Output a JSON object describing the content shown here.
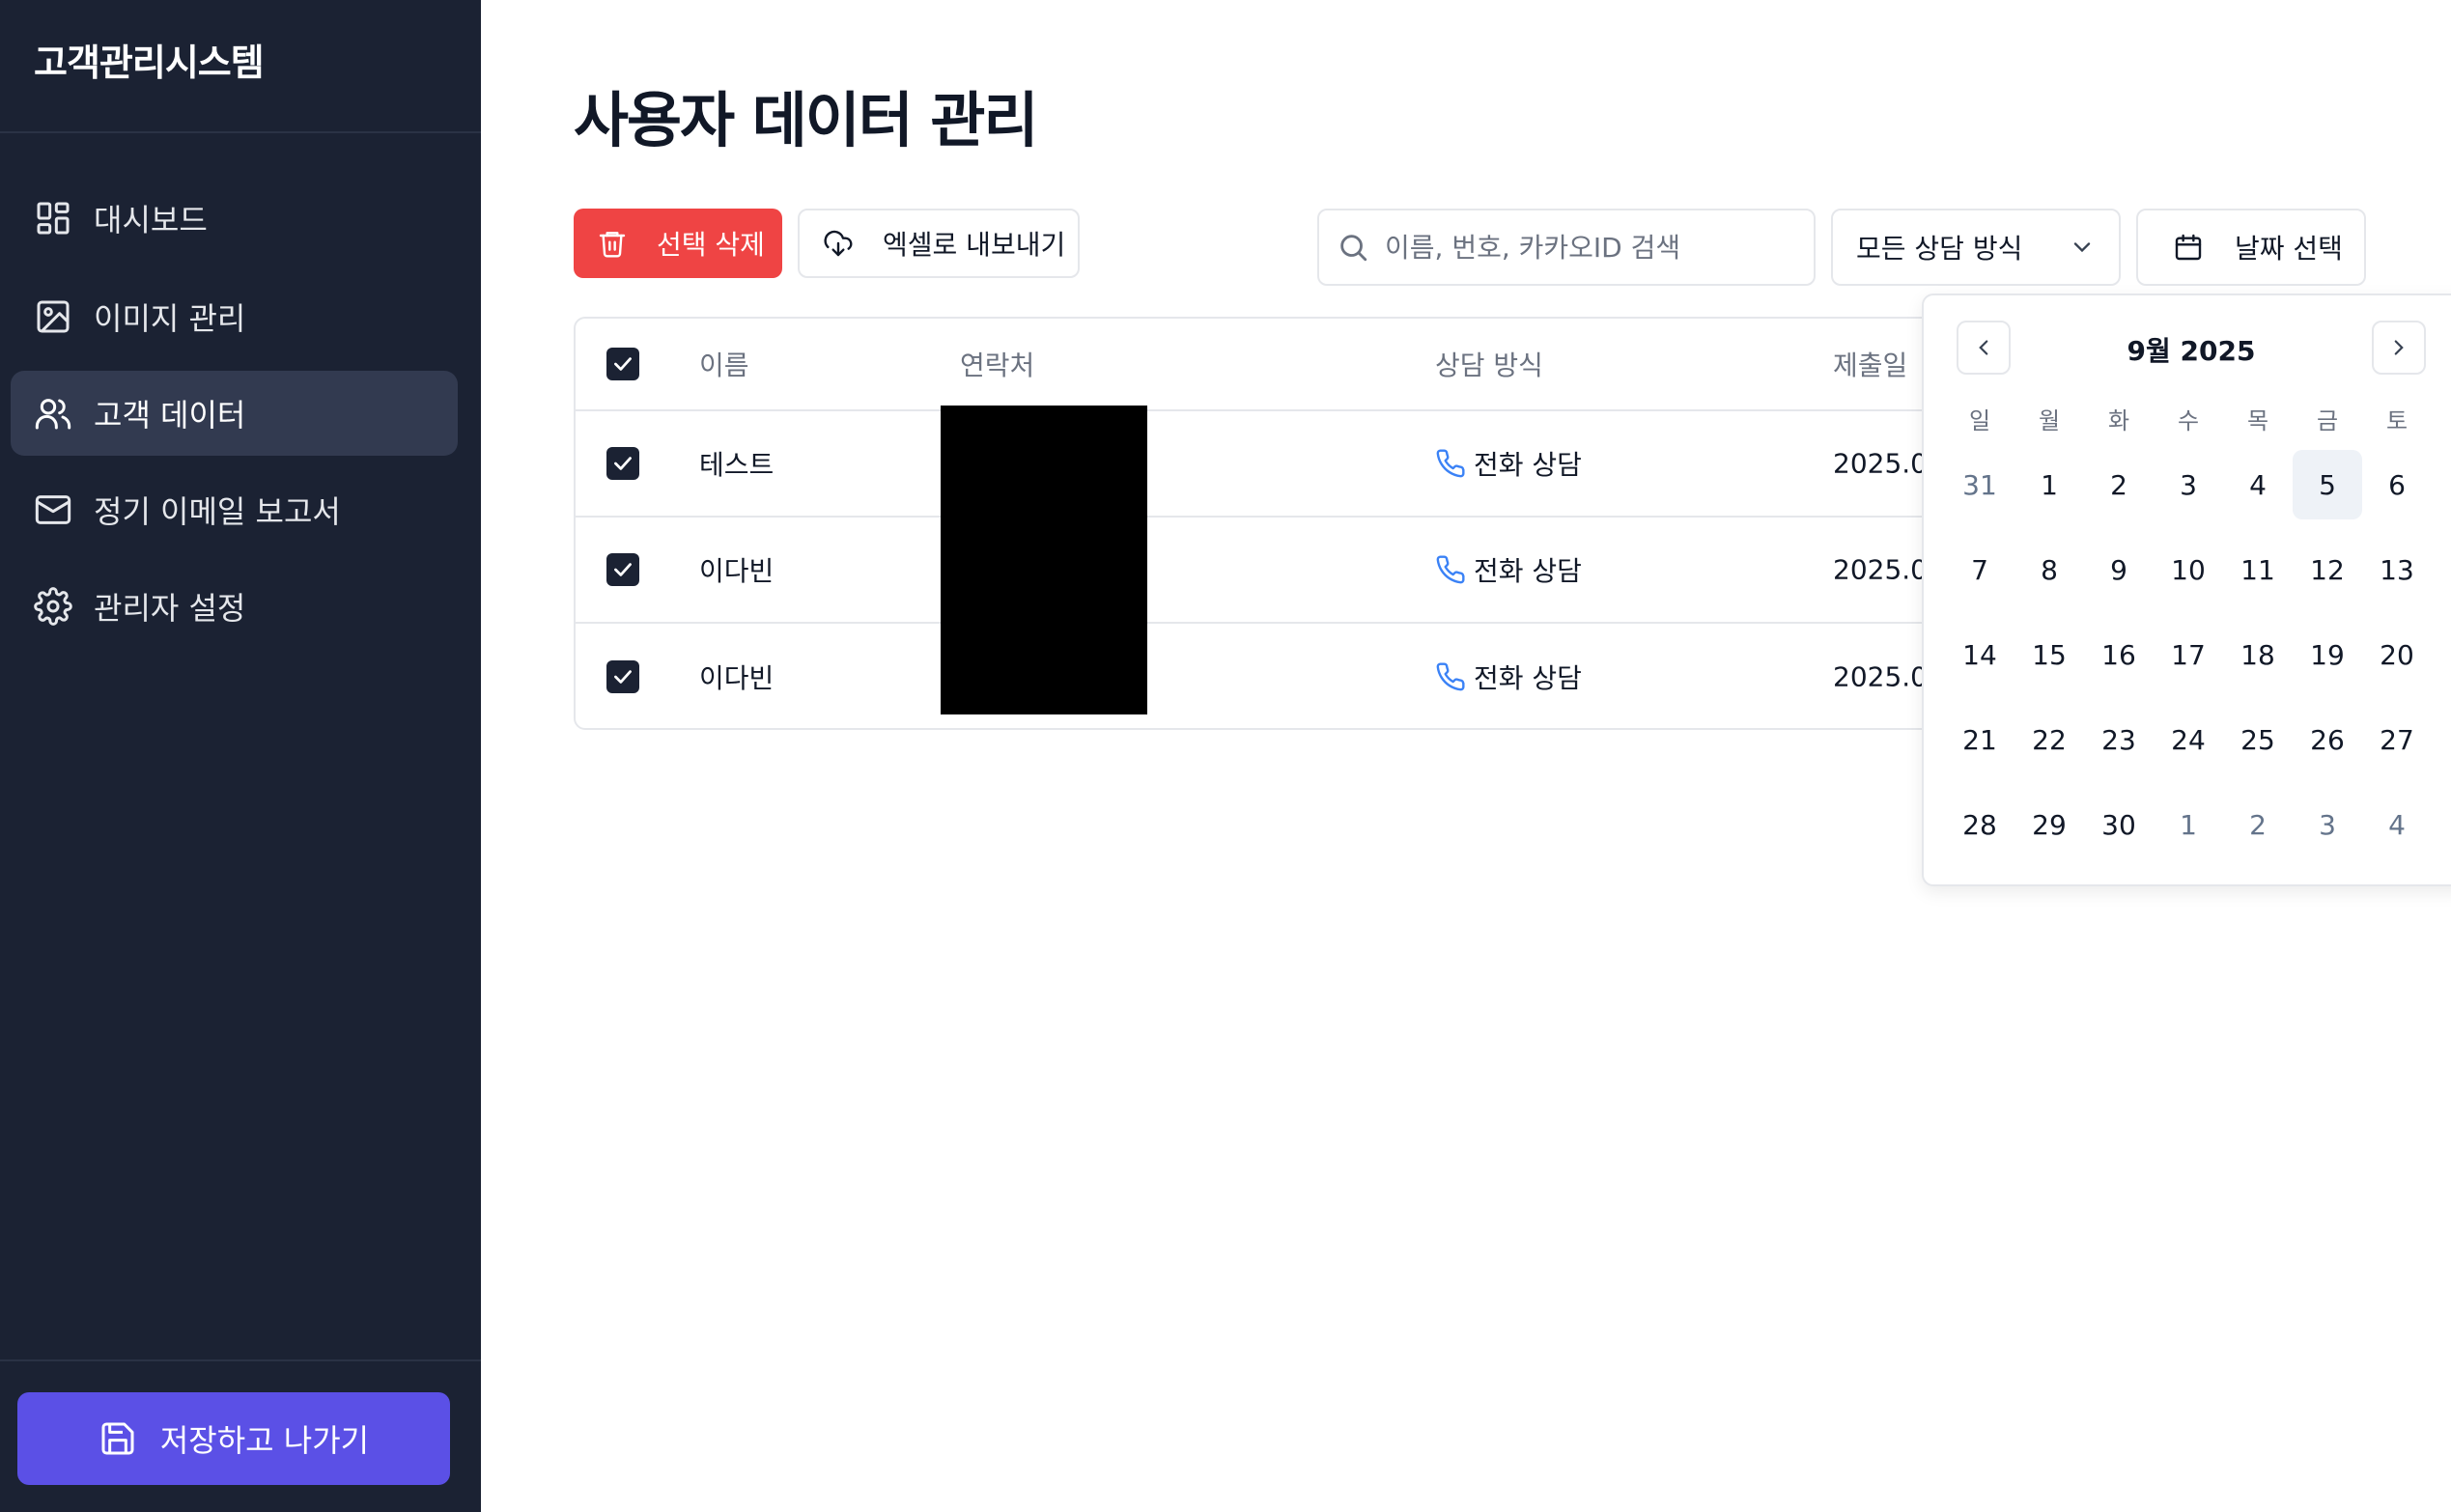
{
  "sidebar": {
    "brand": "고객관리시스템",
    "items": [
      {
        "label": "대시보드",
        "icon": "dashboard-icon"
      },
      {
        "label": "이미지 관리",
        "icon": "image-icon"
      },
      {
        "label": "고객 데이터",
        "icon": "users-icon",
        "active": true
      },
      {
        "label": "정기 이메일 보고서",
        "icon": "mail-icon"
      },
      {
        "label": "관리자 설정",
        "icon": "gear-icon"
      }
    ],
    "save_exit_label": "저장하고 나가기"
  },
  "main": {
    "title": "사용자 데이터 관리",
    "delete_label": "선택 삭제",
    "export_label": "엑셀로 내보내기",
    "search_placeholder": "이름, 번호, 카카오ID 검색",
    "filter_selected": "모든 상담 방식",
    "date_button_label": "날짜 선택"
  },
  "table": {
    "columns": [
      "이름",
      "연락처",
      "상담 방식",
      "제출일"
    ],
    "rows": [
      {
        "name": "테스트",
        "phone": "",
        "method": "전화 상담",
        "date": "2025.0",
        "checked": true
      },
      {
        "name": "이다빈",
        "phone": "",
        "method": "전화 상담",
        "date": "2025.0",
        "checked": true
      },
      {
        "name": "이다빈",
        "phone": "",
        "method": "전화 상담",
        "date": "2025.0",
        "checked": true
      }
    ]
  },
  "calendar": {
    "title": "9월 2025",
    "weekdays": [
      "일",
      "월",
      "화",
      "수",
      "목",
      "금",
      "토"
    ],
    "days": [
      {
        "d": "31",
        "outside": true
      },
      {
        "d": "1"
      },
      {
        "d": "2"
      },
      {
        "d": "3"
      },
      {
        "d": "4"
      },
      {
        "d": "5",
        "today": true
      },
      {
        "d": "6"
      },
      {
        "d": "7"
      },
      {
        "d": "8"
      },
      {
        "d": "9"
      },
      {
        "d": "10"
      },
      {
        "d": "11"
      },
      {
        "d": "12"
      },
      {
        "d": "13"
      },
      {
        "d": "14"
      },
      {
        "d": "15"
      },
      {
        "d": "16"
      },
      {
        "d": "17"
      },
      {
        "d": "18"
      },
      {
        "d": "19"
      },
      {
        "d": "20"
      },
      {
        "d": "21"
      },
      {
        "d": "22"
      },
      {
        "d": "23"
      },
      {
        "d": "24"
      },
      {
        "d": "25"
      },
      {
        "d": "26"
      },
      {
        "d": "27"
      },
      {
        "d": "28"
      },
      {
        "d": "29"
      },
      {
        "d": "30"
      },
      {
        "d": "1",
        "outside": true
      },
      {
        "d": "2",
        "outside": true
      },
      {
        "d": "3",
        "outside": true
      },
      {
        "d": "4",
        "outside": true
      }
    ]
  },
  "colors": {
    "sidebar_bg": "#1b2233",
    "active_item_bg": "#323a50",
    "danger": "#ef4444",
    "primary": "#5b50e6",
    "phone_icon": "#3b82f6"
  }
}
